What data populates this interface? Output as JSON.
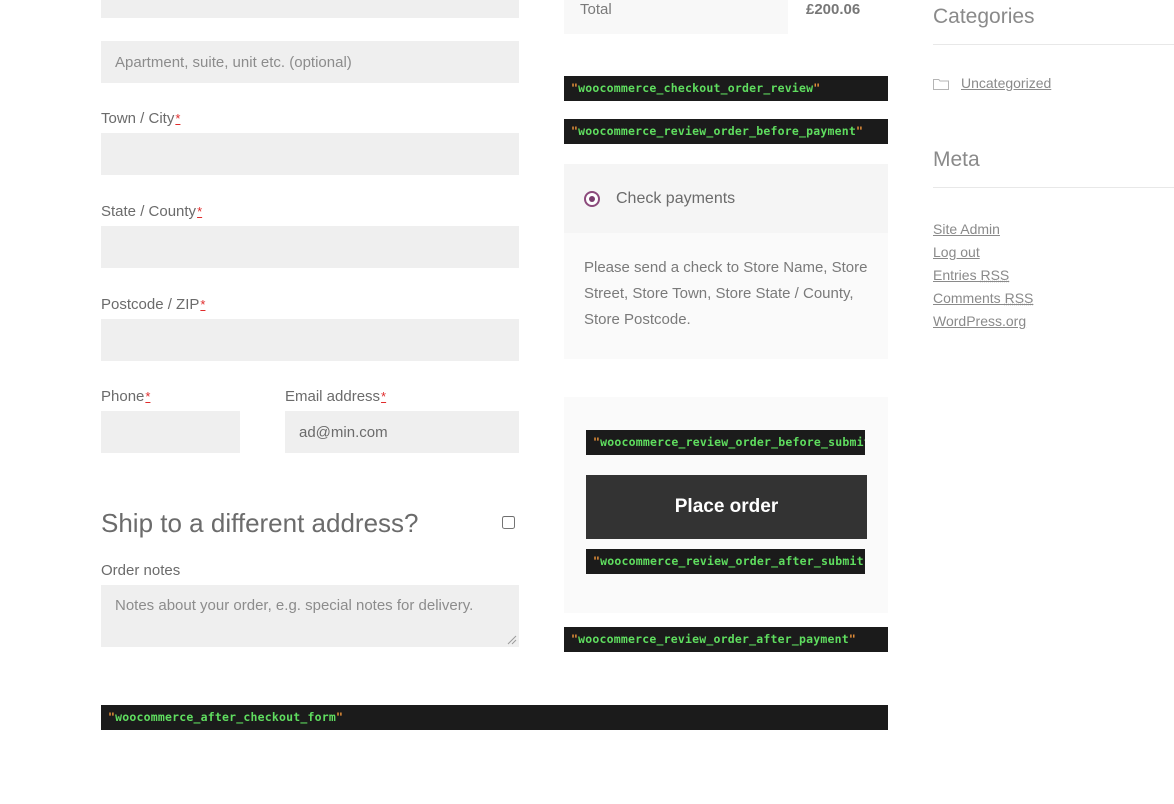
{
  "billing_form": {
    "fields": [
      {
        "name": "address-1",
        "label": "",
        "value": "",
        "placeholder": "",
        "required": false
      },
      {
        "name": "address-2",
        "label": "",
        "value": "",
        "placeholder": "Apartment, suite, unit etc. (optional)",
        "required": false
      },
      {
        "name": "city",
        "label": "Town / City",
        "value": "",
        "placeholder": "",
        "required": true
      },
      {
        "name": "state",
        "label": "State / County",
        "value": "",
        "placeholder": "",
        "required": true
      },
      {
        "name": "postcode",
        "label": "Postcode / ZIP",
        "value": "",
        "placeholder": "",
        "required": true
      },
      {
        "name": "phone",
        "label": "Phone",
        "value": "",
        "placeholder": "",
        "required": true
      },
      {
        "name": "email",
        "label": "Email address",
        "value": "ad@min.com",
        "placeholder": "",
        "required": true
      }
    ],
    "labels": {
      "city": "Town / City",
      "state": "State / County",
      "postcode": "Postcode / ZIP",
      "phone": "Phone",
      "email": "Email address",
      "order_notes": "Order notes"
    },
    "placeholders": {
      "address_2": "Apartment, suite, unit etc. (optional)",
      "order_notes": "Notes about your order, e.g. special notes for delivery."
    },
    "values": {
      "email": "ad@min.com"
    },
    "required_mark": "*",
    "ship_different_address": {
      "title": "Ship to a different address?",
      "checked": false
    }
  },
  "order_review": {
    "totals": {
      "label": "Total",
      "value": "£200.06"
    },
    "payment_method": {
      "name": "Check payments",
      "selected": true,
      "description": "Please send a check to Store Name, Store Street, Store Town, Store State / County, Store Postcode."
    },
    "place_order_label": "Place order"
  },
  "hooks": {
    "checkout_order_review": "\"woocommerce_checkout_order_review\"",
    "review_order_before_payment": "\"woocommerce_review_order_before_payment\"",
    "review_order_before_submit": "\"woocommerce_review_order_before_submit\"",
    "review_order_after_submit": "\"woocommerce_review_order_after_submit\"",
    "review_order_after_payment": "\"woocommerce_review_order_after_payment\"",
    "after_checkout_form": "\"woocommerce_after_checkout_form\""
  },
  "sidebar": {
    "categories": {
      "title": "Categories",
      "items": [
        {
          "label": "Uncategorized",
          "icon": "folder-icon"
        }
      ]
    },
    "meta": {
      "title": "Meta",
      "items": [
        {
          "label": "Site Admin"
        },
        {
          "label": "Log out"
        },
        {
          "label": "Entries RSS"
        },
        {
          "label": "Comments RSS"
        },
        {
          "label": "WordPress.org"
        }
      ]
    }
  },
  "colors": {
    "hook_bg": "#1b1b1b",
    "hook_text": "#5fdd5f",
    "hook_quote": "#e8913a",
    "input_bg": "#efefef",
    "button_bg": "#333333",
    "radio_accent": "#7a3d6e",
    "required_red": "#e02b2b"
  }
}
